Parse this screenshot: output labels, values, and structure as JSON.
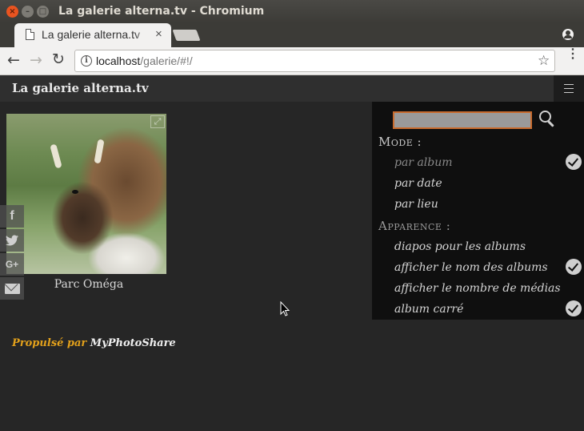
{
  "window": {
    "title": "La galerie alterna.tv - Chromium",
    "close_glyph": "×",
    "min_glyph": "–",
    "max_glyph": "□"
  },
  "tab": {
    "label": "La galerie alterna.tv",
    "close_glyph": "×"
  },
  "toolbar": {
    "back_glyph": "←",
    "forward_glyph": "→",
    "reload_glyph": "↻",
    "info_glyph": "i",
    "url_host": "localhost",
    "url_path": "/galerie/#!/",
    "star_glyph": "☆",
    "menu_glyph": "⋮"
  },
  "site": {
    "title": "La galerie alterna.tv"
  },
  "album": {
    "caption": "Parc Oméga",
    "expand_glyph": "⤢"
  },
  "share": {
    "facebook": "f",
    "twitter": "🐦",
    "google": "G+"
  },
  "footer": {
    "powered": "Propulsé par",
    "brand": "MyPhotoShare"
  },
  "menu": {
    "search_value": "",
    "mode_heading": "Mode :",
    "mode_items": [
      {
        "label": "par album",
        "checked": true
      },
      {
        "label": "par date",
        "checked": false
      },
      {
        "label": "par lieu",
        "checked": false
      }
    ],
    "appearance_heading": "Apparence :",
    "appearance_items": [
      {
        "label": "diapos pour les albums",
        "checked": false
      },
      {
        "label": "afficher le nom des albums",
        "checked": true
      },
      {
        "label": "afficher le nombre de médias",
        "checked": false
      },
      {
        "label": "album carré",
        "checked": true
      }
    ]
  },
  "colors": {
    "accent_orange": "#e3a11b",
    "search_border": "#c86b2e",
    "page_bg": "#262626",
    "menu_bg": "#0f0f0f"
  }
}
